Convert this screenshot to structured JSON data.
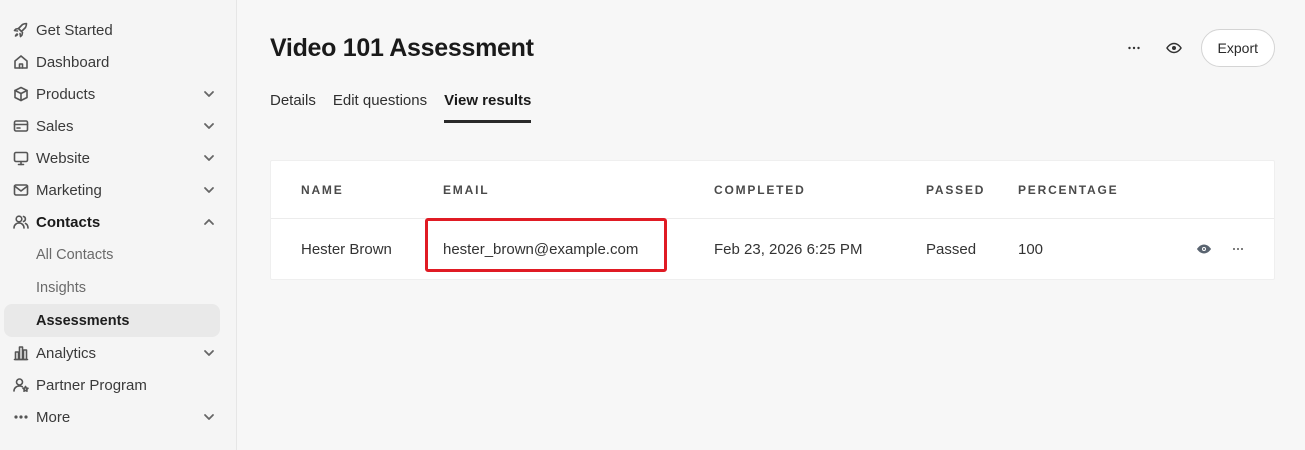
{
  "sidebar": {
    "items": [
      {
        "label": "Get Started",
        "icon": "rocket-icon"
      },
      {
        "label": "Dashboard",
        "icon": "home-icon"
      },
      {
        "label": "Products",
        "icon": "box-icon",
        "expandable": true
      },
      {
        "label": "Sales",
        "icon": "card-icon",
        "expandable": true
      },
      {
        "label": "Website",
        "icon": "monitor-icon",
        "expandable": true
      },
      {
        "label": "Marketing",
        "icon": "mail-icon",
        "expandable": true
      },
      {
        "label": "Contacts",
        "icon": "users-icon",
        "expandable": true,
        "expanded": true
      }
    ],
    "contacts_sub": [
      {
        "label": "All Contacts"
      },
      {
        "label": "Insights"
      },
      {
        "label": "Assessments",
        "active": true
      }
    ],
    "bottom_items": [
      {
        "label": "Analytics",
        "icon": "chart-icon",
        "expandable": true
      },
      {
        "label": "Partner Program",
        "icon": "partner-icon"
      },
      {
        "label": "More",
        "icon": "ellipsis-icon",
        "expandable": true
      }
    ]
  },
  "header": {
    "title": "Video 101 Assessment",
    "export_label": "Export"
  },
  "tabs": [
    {
      "label": "Details"
    },
    {
      "label": "Edit questions"
    },
    {
      "label": "View results",
      "active": true
    }
  ],
  "table": {
    "columns": [
      "NAME",
      "EMAIL",
      "COMPLETED",
      "PASSED",
      "PERCENTAGE"
    ],
    "rows": [
      {
        "name": "Hester Brown",
        "email": "hester_brown@example.com",
        "completed": "Feb 23, 2026 6:25 PM",
        "passed": "Passed",
        "percentage": "100"
      }
    ]
  },
  "colors": {
    "highlight": "#e01b24",
    "active_tab_underline": "#2a2a2a"
  }
}
